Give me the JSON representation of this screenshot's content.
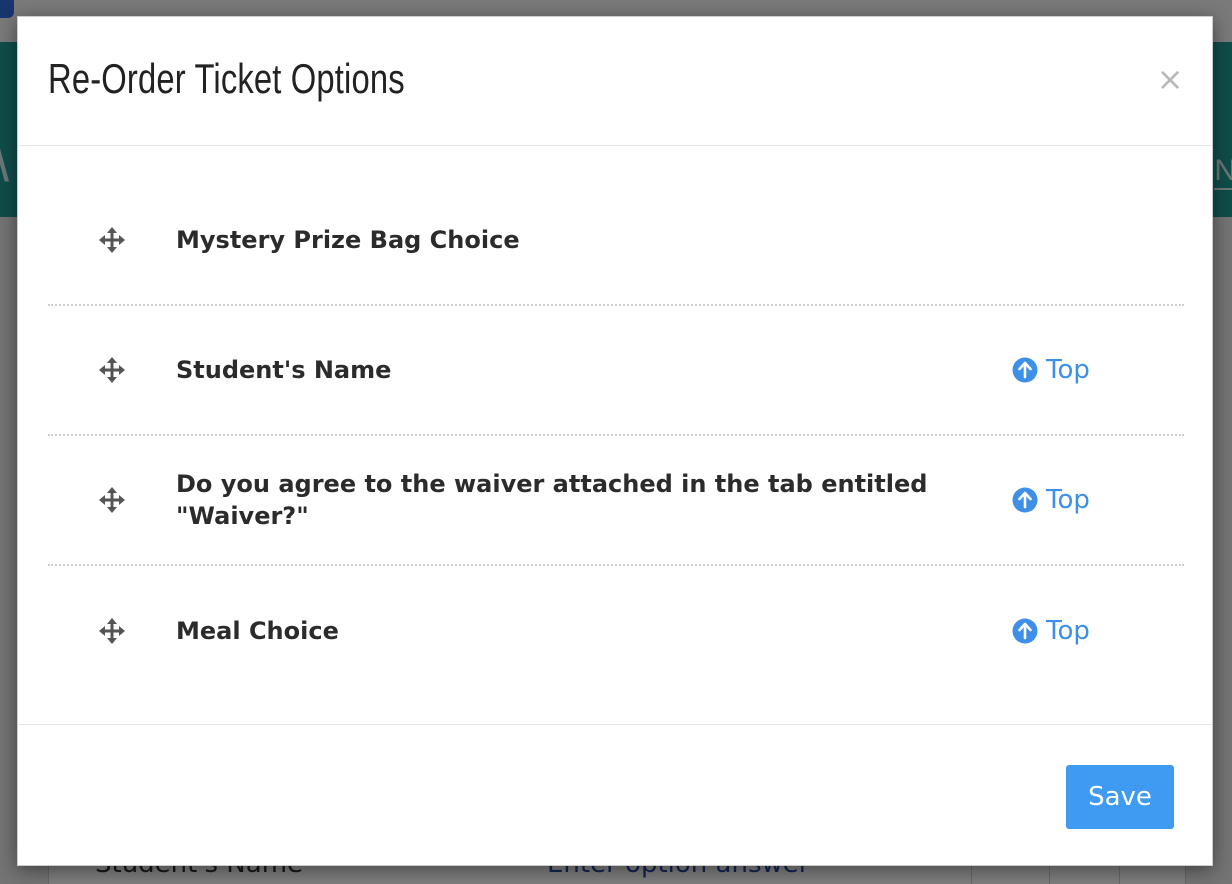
{
  "background": {
    "row_name": "Student's Name",
    "row_answer": "Enter option answer"
  },
  "modal": {
    "title": "Re-Order Ticket Options",
    "close_label": "×",
    "options": [
      {
        "label": "Mystery Prize Bag Choice",
        "top_label": ""
      },
      {
        "label": "Student's Name",
        "top_label": "Top"
      },
      {
        "label": "Do you agree to the waiver attached in the tab entitled \"Waiver?\"",
        "top_label": "Top"
      },
      {
        "label": "Meal Choice",
        "top_label": "Top"
      }
    ],
    "save_label": "Save"
  },
  "icons": {
    "drag": "move-arrows-icon",
    "top": "arrow-circle-up-icon",
    "close": "close-icon"
  },
  "colors": {
    "accent": "#3f9bf2",
    "link": "#3d8fe8",
    "teal_header": "#1f9a94"
  }
}
